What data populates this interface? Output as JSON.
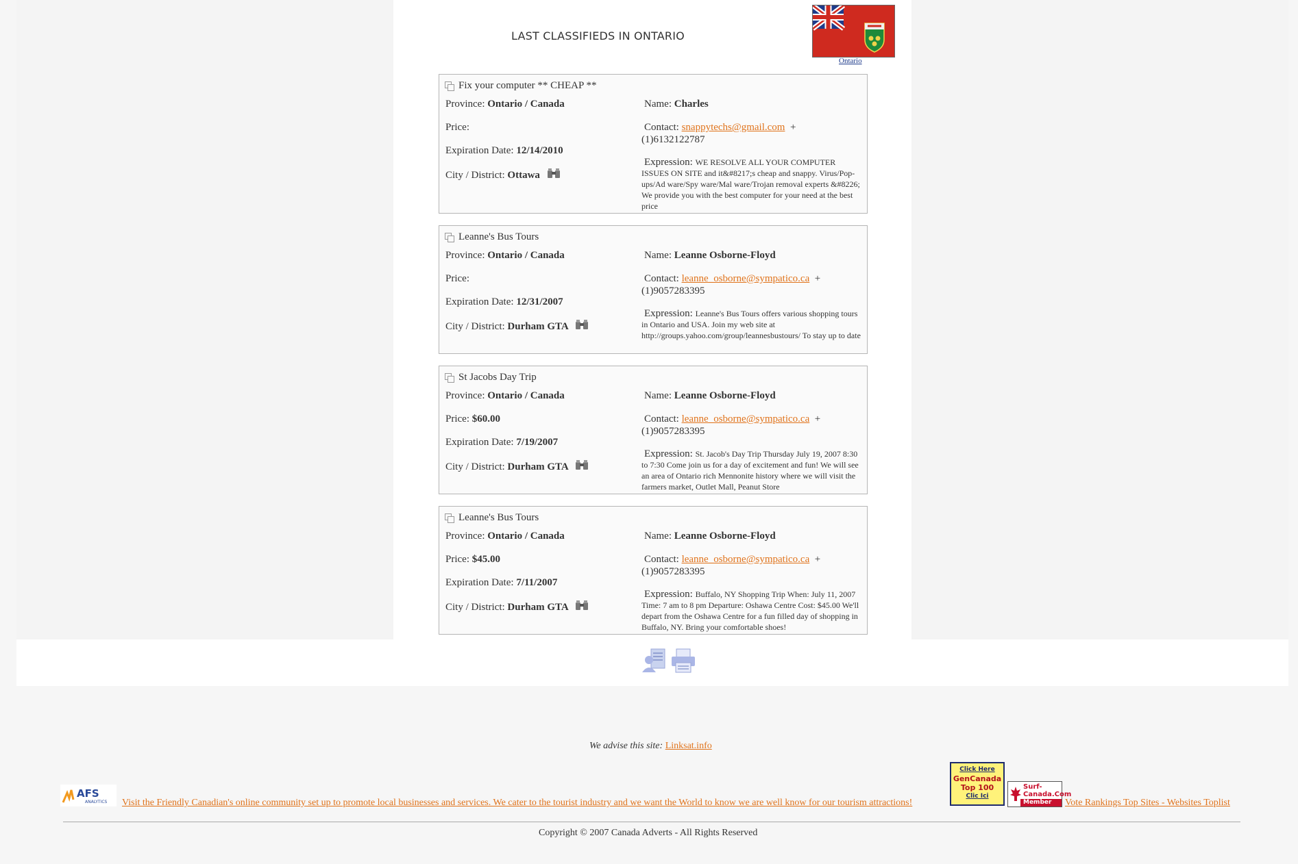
{
  "page": {
    "heading": "LAST CLASSIFIEDS IN ONTARIO",
    "flag_link": "Ontario"
  },
  "labels": {
    "province": "Province:",
    "price": "Price:",
    "expiration": "Expiration Date:",
    "city": "City / District:",
    "name": "Name:",
    "contact": "Contact:",
    "expression": "Expression:"
  },
  "ads": [
    {
      "title": "Fix your computer ** CHEAP **",
      "province": "Ontario / Canada",
      "price": "",
      "expiration": "12/14/2010",
      "city": "Ottawa",
      "name": "Charles",
      "email": "snappytechs@gmail.com",
      "phone": "(1)6132122787",
      "expression": "WE RESOLVE ALL YOUR COMPUTER ISSUES ON SITE and it&#8217;s cheap and snappy. Virus/Pop-ups/Ad ware/Spy ware/Mal ware/Trojan removal experts &#8226; We provide you with the best computer for your need at the best price"
    },
    {
      "title": "Leanne's Bus Tours",
      "province": "Ontario / Canada",
      "price": "",
      "expiration": "12/31/2007",
      "city": "Durham GTA",
      "name": "Leanne Osborne-Floyd",
      "email": "leanne_osborne@sympatico.ca",
      "phone": "(1)9057283395",
      "expression": "Leanne's Bus Tours offers various shopping tours in Ontario and USA. Join my web site at http://groups.yahoo.com/group/leannesbustours/ To stay up to date"
    },
    {
      "title": "St Jacobs Day Trip",
      "province": "Ontario / Canada",
      "price": "$60.00",
      "expiration": "7/19/2007",
      "city": "Durham GTA",
      "name": "Leanne Osborne-Floyd",
      "email": "leanne_osborne@sympatico.ca",
      "phone": "(1)9057283395",
      "expression": "St. Jacob's Day Trip Thursday July 19, 2007 8:30 to 7:30 Come join us for a day of excitement and fun! We will see an area of Ontario rich Mennonite history where we will visit the farmers market, Outlet Mall, Peanut Store"
    },
    {
      "title": "Leanne's Bus Tours",
      "province": "Ontario / Canada",
      "price": "$45.00",
      "expiration": "7/11/2007",
      "city": "Durham GTA",
      "name": "Leanne Osborne-Floyd",
      "email": "leanne_osborne@sympatico.ca",
      "phone": "(1)9057283395",
      "expression": "Buffalo, NY Shopping Trip When: July 11, 2007 Time: 7 am to 8 pm Departure: Oshawa Centre Cost: $45.00 We'll depart from the Oshawa Centre for a fun filled day of shopping in Buffalo, NY. Bring your comfortable shoes!"
    }
  ],
  "footer": {
    "advise_text": "We advise this site:",
    "advise_link": "Linksat.info",
    "afs_logo": "AFS",
    "afs_sub": "ANALYTICS",
    "banner_alt": "Visit the Friendly Canadian's online community set up to promote local businesses and services. We cater to the tourist industry and we want the World to know we are well know for our tourism attractions!",
    "gencanada_top": "Click Here",
    "gencanada_line1": "GenCanada",
    "gencanada_line2": "Top 100",
    "gencanada_bottom": "Clic Ici",
    "surf_line1": "Surf-",
    "surf_line2": "Canada.Com",
    "surf_member": "Member",
    "vote_alt": "Vote Rankings Top Sites - Websites Toplist",
    "copyright": "Copyright © 2007 Canada Adverts - All Rights Reserved"
  },
  "colors": {
    "link": "#e0731b",
    "flag_red": "#cf2a1f",
    "background": "#f6f6f6"
  }
}
